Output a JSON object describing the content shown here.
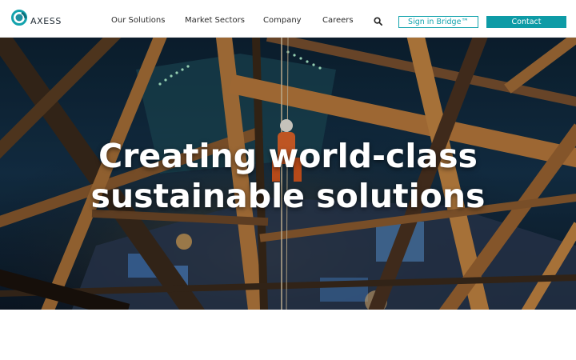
{
  "brand": {
    "name": "AXESS",
    "accent_color": "#13a3ad"
  },
  "nav": {
    "items": [
      {
        "label": "Our Solutions"
      },
      {
        "label": "Market Sectors"
      },
      {
        "label": "Company"
      },
      {
        "label": "Careers"
      }
    ],
    "search_icon": "search-icon"
  },
  "actions": {
    "sign_in_label": "Sign in Bridge™",
    "contact_label": "Contact"
  },
  "hero": {
    "title_line1": "Creating world-class",
    "title_line2": "sustainable solutions",
    "image_description_icon": "offshore-structure-photo"
  }
}
